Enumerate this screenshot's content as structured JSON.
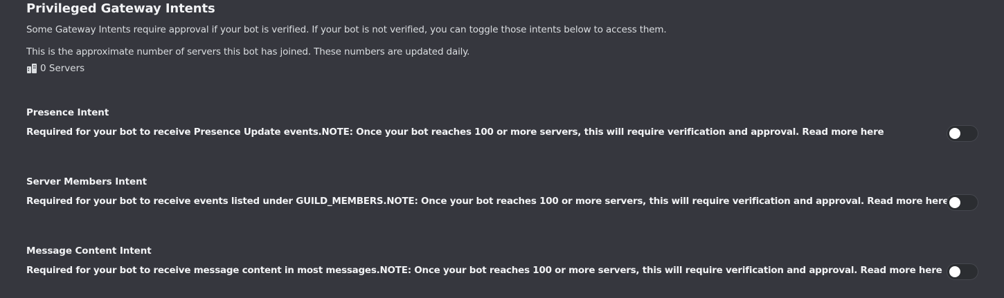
{
  "section": {
    "title": "Privileged Gateway Intents",
    "description": "Some Gateway Intents require approval if your bot is verified. If your bot is not verified, you can toggle those intents below to access them.",
    "server_note": "This is the approximate number of servers this bot has joined. These numbers are updated daily.",
    "server_count": "0 Servers",
    "server_icon": "servers-icon"
  },
  "intents": [
    {
      "name": "Presence Intent",
      "description": "Required for your bot to receive Presence Update events.NOTE: Once your bot reaches 100 or more servers, this will require verification and approval. Read more here",
      "enabled": false
    },
    {
      "name": "Server Members Intent",
      "description": "Required for your bot to receive events listed under GUILD_MEMBERS.NOTE: Once your bot reaches 100 or more servers, this will require verification and approval. Read more here",
      "enabled": false
    },
    {
      "name": "Message Content Intent",
      "description": "Required for your bot to receive message content in most messages.NOTE: Once your bot reaches 100 or more servers, this will require verification and approval. Read more here",
      "enabled": false
    }
  ],
  "colors": {
    "background": "#36373e",
    "heading": "#f2f3f5",
    "text": "#dbdee1",
    "toggle_off_track": "#2b2d31",
    "toggle_knob": "#ffffff"
  }
}
